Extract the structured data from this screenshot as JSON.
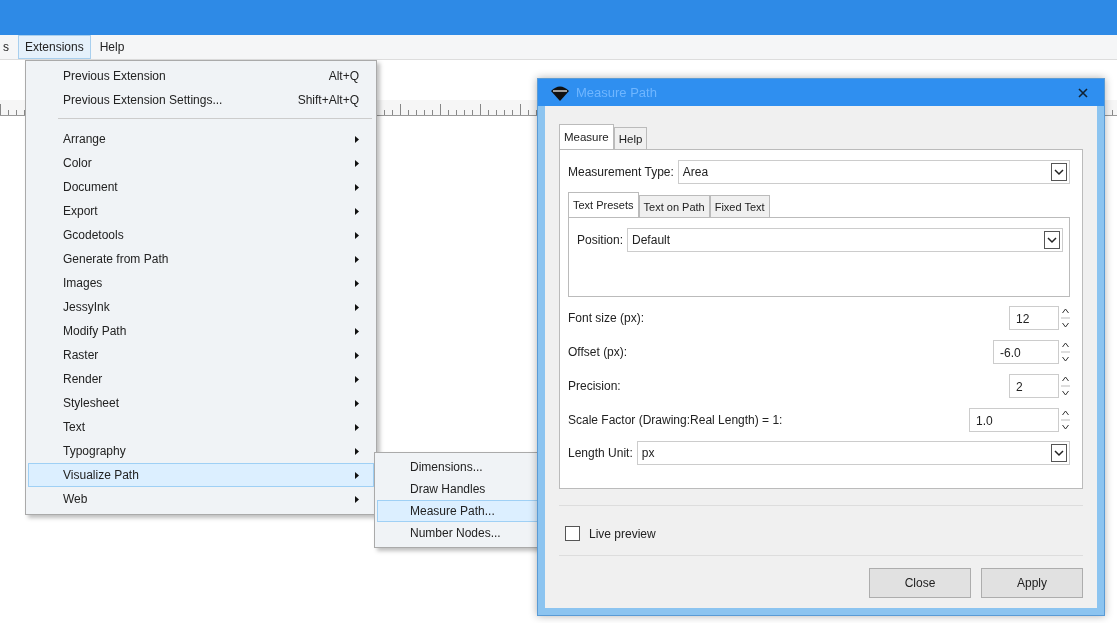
{
  "menubar": [
    {
      "label": "s",
      "selected": false
    },
    {
      "label": "Extensions",
      "selected": true
    },
    {
      "label": "Help",
      "selected": false
    }
  ],
  "extensions_menu": [
    {
      "kind": "command",
      "label": "Previous Extension",
      "shortcut": "Alt+Q",
      "selected": false
    },
    {
      "kind": "command",
      "label": "Previous Extension Settings...",
      "shortcut": "Shift+Alt+Q",
      "selected": false
    },
    {
      "kind": "separator"
    },
    {
      "kind": "submenu",
      "label": "Arrange",
      "selected": false
    },
    {
      "kind": "submenu",
      "label": "Color",
      "selected": false
    },
    {
      "kind": "submenu",
      "label": "Document",
      "selected": false
    },
    {
      "kind": "submenu",
      "label": "Export",
      "selected": false
    },
    {
      "kind": "submenu",
      "label": "Gcodetools",
      "selected": false
    },
    {
      "kind": "submenu",
      "label": "Generate from Path",
      "selected": false
    },
    {
      "kind": "submenu",
      "label": "Images",
      "selected": false
    },
    {
      "kind": "submenu",
      "label": "JessyInk",
      "selected": false
    },
    {
      "kind": "submenu",
      "label": "Modify Path",
      "selected": false
    },
    {
      "kind": "submenu",
      "label": "Raster",
      "selected": false
    },
    {
      "kind": "submenu",
      "label": "Render",
      "selected": false
    },
    {
      "kind": "submenu",
      "label": "Stylesheet",
      "selected": false
    },
    {
      "kind": "submenu",
      "label": "Text",
      "selected": false
    },
    {
      "kind": "submenu",
      "label": "Typography",
      "selected": false
    },
    {
      "kind": "submenu",
      "label": "Visualize Path",
      "selected": true
    },
    {
      "kind": "submenu",
      "label": "Web",
      "selected": false
    }
  ],
  "visualize_path_submenu": [
    {
      "label": "Dimensions...",
      "selected": false
    },
    {
      "label": "Draw Handles",
      "selected": false
    },
    {
      "label": "Measure Path...",
      "selected": true
    },
    {
      "label": "Number Nodes...",
      "selected": false
    }
  ],
  "dialog": {
    "title": "Measure Path",
    "tabs": [
      {
        "label": "Measure",
        "selected": true
      },
      {
        "label": "Help",
        "selected": false
      }
    ],
    "measurement_type": {
      "label": "Measurement Type:",
      "value": "Area"
    },
    "subtabs": [
      {
        "label": "Text Presets",
        "selected": true
      },
      {
        "label": "Text on Path",
        "selected": false
      },
      {
        "label": "Fixed Text",
        "selected": false
      }
    ],
    "position": {
      "label": "Position:",
      "value": "Default"
    },
    "spin_fields": [
      {
        "label": "Font size (px):",
        "value": "12"
      },
      {
        "label": "Offset (px):",
        "value": "-6.0"
      },
      {
        "label": "Precision:",
        "value": "2"
      },
      {
        "label": "Scale Factor (Drawing:Real Length) = 1:",
        "value": "1.0"
      }
    ],
    "length_unit": {
      "label": "Length Unit:",
      "value": "px"
    },
    "live_preview": {
      "label": "Live preview",
      "checked": false
    },
    "buttons": [
      "Close",
      "Apply"
    ]
  }
}
